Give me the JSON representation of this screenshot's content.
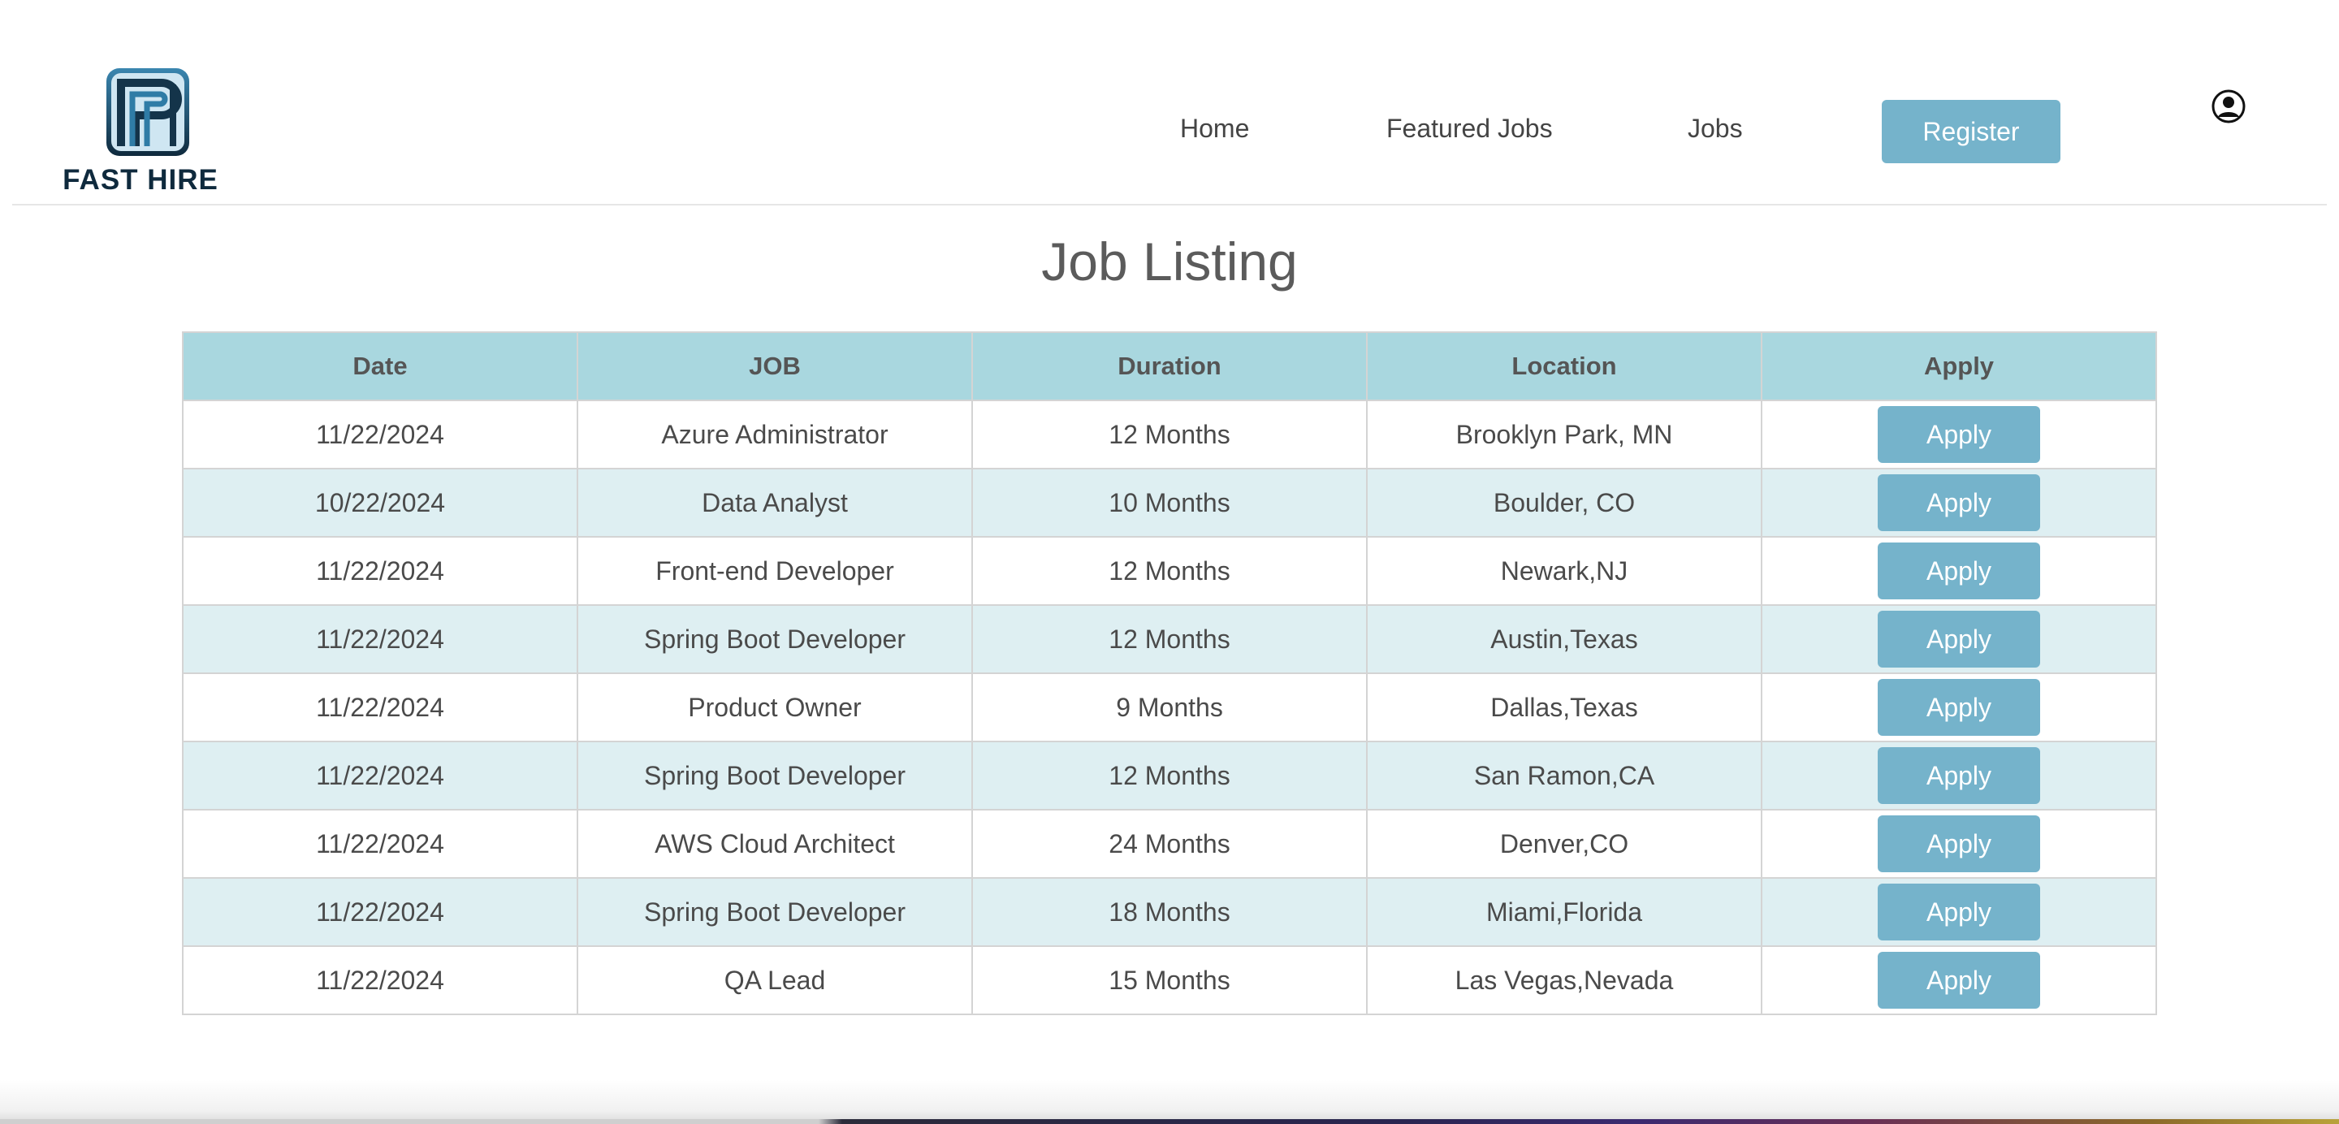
{
  "brand": {
    "name": "FAST HIRE",
    "colors": {
      "primary": "#75b3cb",
      "header_bg": "#a9d7df",
      "stripe": "#deeff2",
      "logo_dark": "#0f2a3d"
    }
  },
  "nav": {
    "items": [
      {
        "label": "Home"
      },
      {
        "label": "Featured Jobs"
      },
      {
        "label": "Jobs"
      }
    ],
    "register_label": "Register",
    "user_icon": "user-circle-icon"
  },
  "page": {
    "title": "Job Listing"
  },
  "table": {
    "headers": [
      "Date",
      "JOB",
      "Duration",
      "Location",
      "Apply"
    ],
    "rows": [
      {
        "date": "11/22/2024",
        "job": "Azure Administrator",
        "duration": "12 Months",
        "location": "Brooklyn Park, MN",
        "apply": "Apply"
      },
      {
        "date": "10/22/2024",
        "job": "Data Analyst",
        "duration": "10 Months",
        "location": "Boulder, CO",
        "apply": "Apply"
      },
      {
        "date": "11/22/2024",
        "job": "Front-end Developer",
        "duration": "12 Months",
        "location": "Newark,NJ",
        "apply": "Apply"
      },
      {
        "date": "11/22/2024",
        "job": "Spring Boot Developer",
        "duration": "12 Months",
        "location": "Austin,Texas",
        "apply": "Apply"
      },
      {
        "date": "11/22/2024",
        "job": "Product Owner",
        "duration": "9 Months",
        "location": "Dallas,Texas",
        "apply": "Apply"
      },
      {
        "date": "11/22/2024",
        "job": "Spring Boot Developer",
        "duration": "12 Months",
        "location": "San Ramon,CA",
        "apply": "Apply"
      },
      {
        "date": "11/22/2024",
        "job": "AWS Cloud Architect",
        "duration": "24 Months",
        "location": "Denver,CO",
        "apply": "Apply"
      },
      {
        "date": "11/22/2024",
        "job": "Spring Boot Developer",
        "duration": "18 Months",
        "location": "Miami,Florida",
        "apply": "Apply"
      },
      {
        "date": "11/22/2024",
        "job": "QA Lead",
        "duration": "15 Months",
        "location": "Las Vegas,Nevada",
        "apply": "Apply"
      }
    ]
  }
}
